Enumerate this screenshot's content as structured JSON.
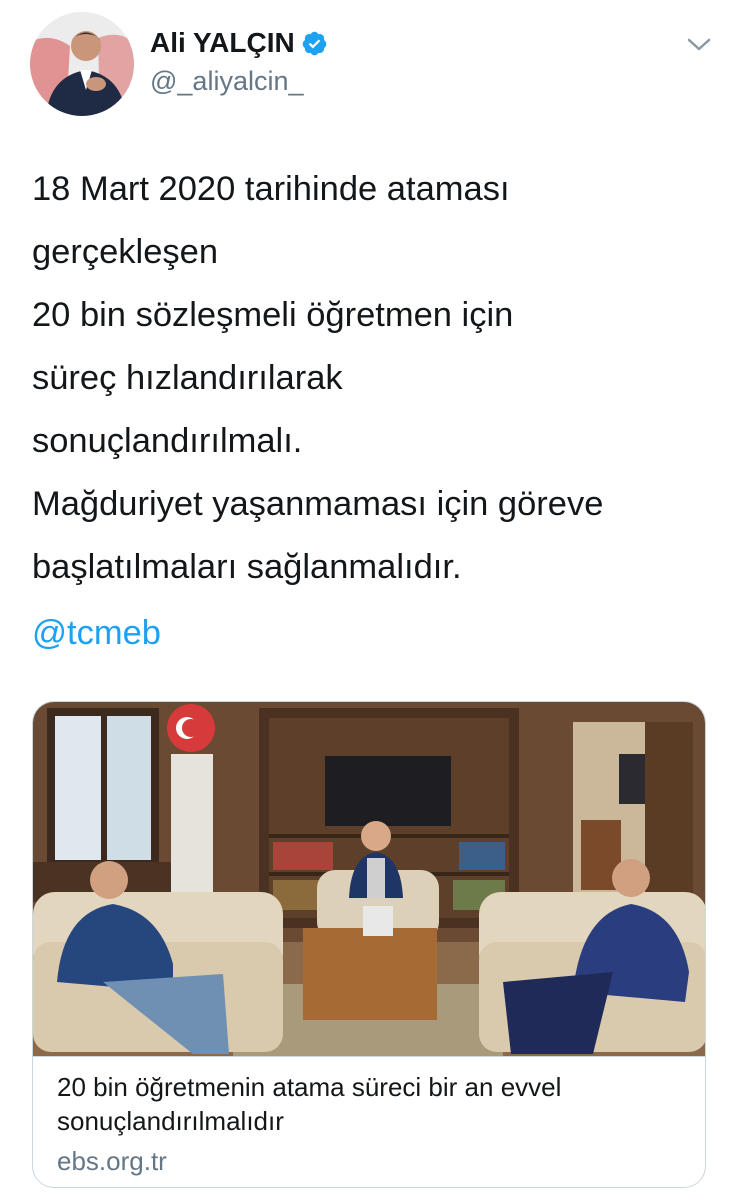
{
  "author": {
    "name": "Ali YALÇIN",
    "handle": "@_aliyalcin_",
    "verified": true
  },
  "tweet": {
    "lines": [
      "18 Mart 2020 tarihinde ataması",
      "gerçekleşen",
      "20 bin sözleşmeli öğretmen için",
      "süreç hızlandırılarak",
      "sonuçlandırılmalı.",
      "Mağduriyet yaşanmaması için göreve",
      "başlatılmaları sağlanmalıdır."
    ],
    "mention": "@tcmeb"
  },
  "card": {
    "title_lines": [
      "20 bin öğretmenin atama süreci bir an evvel",
      "sonuçlandırılmalıdır"
    ],
    "domain": "ebs.org.tr"
  },
  "colors": {
    "link": "#1da1f2",
    "secondary_text": "#657786",
    "verified_badge": "#1da1f2",
    "border": "#ccd6dd"
  }
}
